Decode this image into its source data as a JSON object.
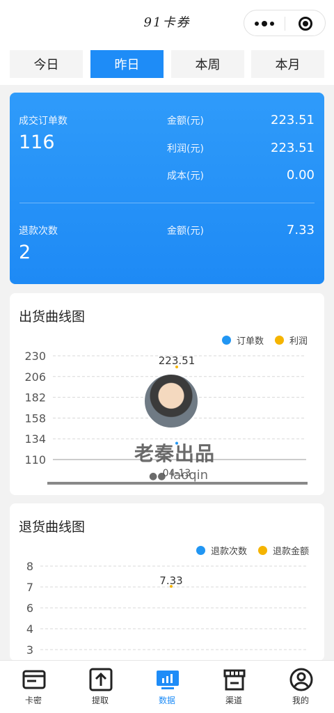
{
  "nav": {
    "title": "91卡券"
  },
  "tabs": [
    {
      "label": "今日",
      "active": false
    },
    {
      "label": "昨日",
      "active": true
    },
    {
      "label": "本周",
      "active": false
    },
    {
      "label": "本月",
      "active": false
    }
  ],
  "summary": {
    "orders_label": "成交订单数",
    "orders_value": "116",
    "amount_label": "金额(元)",
    "amount_value": "223.51",
    "profit_label": "利润(元)",
    "profit_value": "223.51",
    "cost_label": "成本(元)",
    "cost_value": "0.00",
    "refund_label": "退款次数",
    "refund_value": "2",
    "refund_amount_label": "金额(元)",
    "refund_amount_value": "7.33"
  },
  "shipment_chart": {
    "title": "出货曲线图",
    "legend": [
      "订单数",
      "利润"
    ],
    "colors": [
      "#2196f3",
      "#f5b400"
    ]
  },
  "refund_chart": {
    "title": "退货曲线图",
    "legend": [
      "退款次数",
      "退款金额"
    ],
    "colors": [
      "#2196f3",
      "#f5b400"
    ]
  },
  "chart_data": [
    {
      "type": "line",
      "categories": [
        "04-13"
      ],
      "series": [
        {
          "name": "订单数",
          "values": [
            116
          ]
        },
        {
          "name": "利润",
          "values": [
            223.51
          ]
        }
      ],
      "yticks": [
        110,
        134,
        158,
        182,
        206,
        230
      ],
      "ylim": [
        110,
        230
      ],
      "data_labels": [
        "223.51"
      ]
    },
    {
      "type": "line",
      "categories": [],
      "series": [
        {
          "name": "退款次数",
          "values": [
            2
          ]
        },
        {
          "name": "退款金额",
          "values": [
            7.33
          ]
        }
      ],
      "yticks": [
        3,
        4,
        6,
        7,
        8
      ],
      "data_labels": [
        "7.33"
      ]
    }
  ],
  "watermark": {
    "text": "老秦出品",
    "sub": "laoqin"
  },
  "tabbar": [
    {
      "label": "卡密",
      "icon": "card-icon",
      "active": false
    },
    {
      "label": "提取",
      "icon": "upload-icon",
      "active": false
    },
    {
      "label": "数据",
      "icon": "chart-monitor-icon",
      "active": true
    },
    {
      "label": "渠道",
      "icon": "store-icon",
      "active": false
    },
    {
      "label": "我的",
      "icon": "user-icon",
      "active": false
    }
  ]
}
